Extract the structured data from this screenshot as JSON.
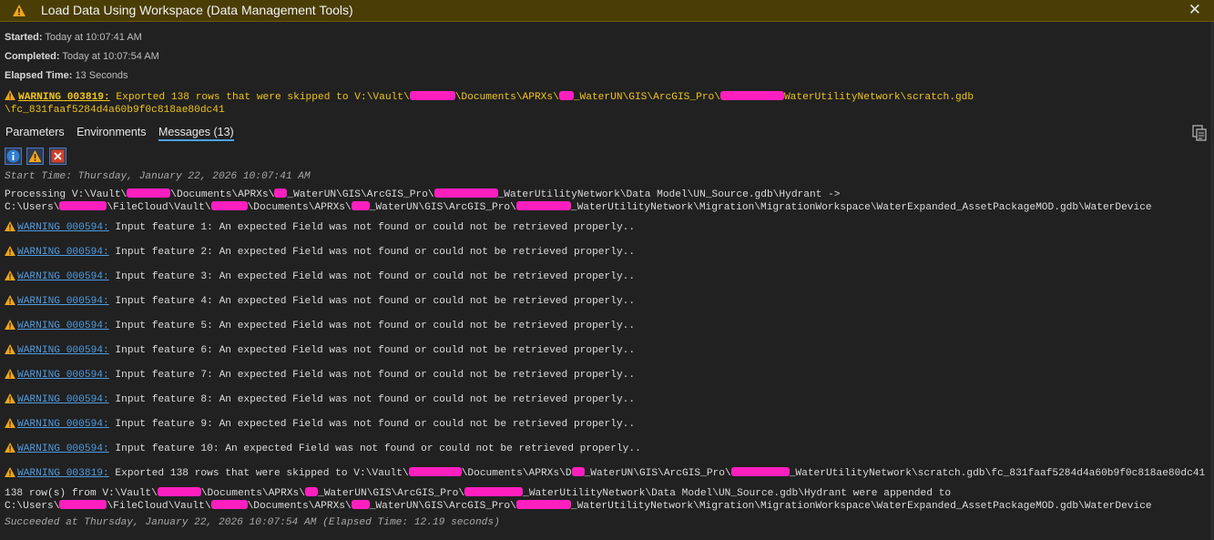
{
  "window": {
    "title": "Load Data Using Workspace (Data Management Tools)",
    "title_icon": "warning-icon",
    "close_icon": "close-icon",
    "accent_color": "#4a3d05"
  },
  "meta": {
    "started_label": "Started:",
    "started_value": "Today at 10:07:41 AM",
    "completed_label": "Completed:",
    "completed_value": "Today at 10:07:54 AM",
    "elapsed_label": "Elapsed Time:",
    "elapsed_value": "13 Seconds"
  },
  "top_warning": {
    "code": "WARNING 003819:",
    "text1": " Exported 138 rows that were skipped to V:\\Vault\\",
    "text2": "\\Documents\\APRXs\\",
    "text3": "_WaterUN\\GIS\\ArcGIS_Pro\\",
    "text4": "WaterUtilityNetwork\\scratch.gdb",
    "line2": "\\fc_831faaf5284d4a60b9f0c818ae80dc41"
  },
  "tabs": [
    {
      "label": "Parameters",
      "active": false
    },
    {
      "label": "Environments",
      "active": false
    },
    {
      "label": "Messages (13)",
      "active": true
    }
  ],
  "filters": {
    "info_icon": "info-icon",
    "warning_icon": "warning-icon",
    "error_icon": "error-icon"
  },
  "messages": {
    "start_time": "Start Time: Thursday, January 22, 2026 10:07:41 AM",
    "proc_a1": "Processing V:\\Vault\\",
    "proc_a2": "\\Documents\\APRXs\\",
    "proc_a3": "_WaterUN\\GIS\\ArcGIS_Pro\\",
    "proc_a4": "_WaterUtilityNetwork\\Data Model\\UN_Source.gdb\\Hydrant ->",
    "proc_b1": "C:\\Users\\",
    "proc_b2": "\\FileCloud\\Vault\\",
    "proc_b3": "\\Documents\\APRXs\\",
    "proc_b4": "_WaterUN\\GIS\\ArcGIS_Pro\\",
    "proc_b5": "_WaterUtilityNetwork\\Migration\\MigrationWorkspace\\WaterExpanded_AssetPackageMOD.gdb\\WaterDevice",
    "warnings": [
      {
        "code": "WARNING 000594:",
        "text": " Input feature 1: An expected Field was not found or could not be retrieved properly.."
      },
      {
        "code": "WARNING 000594:",
        "text": " Input feature 2: An expected Field was not found or could not be retrieved properly.."
      },
      {
        "code": "WARNING 000594:",
        "text": " Input feature 3: An expected Field was not found or could not be retrieved properly.."
      },
      {
        "code": "WARNING 000594:",
        "text": " Input feature 4: An expected Field was not found or could not be retrieved properly.."
      },
      {
        "code": "WARNING 000594:",
        "text": " Input feature 5: An expected Field was not found or could not be retrieved properly.."
      },
      {
        "code": "WARNING 000594:",
        "text": " Input feature 6: An expected Field was not found or could not be retrieved properly.."
      },
      {
        "code": "WARNING 000594:",
        "text": " Input feature 7: An expected Field was not found or could not be retrieved properly.."
      },
      {
        "code": "WARNING 000594:",
        "text": " Input feature 8: An expected Field was not found or could not be retrieved properly.."
      },
      {
        "code": "WARNING 000594:",
        "text": " Input feature 9: An expected Field was not found or could not be retrieved properly.."
      },
      {
        "code": "WARNING 000594:",
        "text": " Input feature 10: An expected Field was not found or could not be retrieved properly.."
      }
    ],
    "w11_code": "WARNING 003819:",
    "w11_t1": " Exported 138 rows that were skipped to V:\\Vault\\",
    "w11_t2": "\\Documents\\APRXs\\D",
    "w11_t3": "_WaterUN\\GIS\\ArcGIS_Pro\\",
    "w11_t4": "_WaterUtilityNetwork\\scratch.gdb\\fc_831faaf5284d4a60b9f0c818ae80dc41",
    "app_a1": "138 row(s) from V:\\Vault\\",
    "app_a2": "\\Documents\\APRXs\\",
    "app_a3": "_WaterUN\\GIS\\ArcGIS_Pro\\",
    "app_a4": "_WaterUtilityNetwork\\Data Model\\UN_Source.gdb\\Hydrant were appended to",
    "app_b1": "C:\\Users\\",
    "app_b2": "\\FileCloud\\Vault\\",
    "app_b3": "\\Documents\\APRXs\\",
    "app_b4": "_WaterUN\\GIS\\ArcGIS_Pro\\",
    "app_b5": "_WaterUtilityNetwork\\Migration\\MigrationWorkspace\\WaterExpanded_AssetPackageMOD.gdb\\WaterDevice",
    "succeeded": "Succeeded at Thursday, January 22, 2026 10:07:54 AM (Elapsed Time: 12.19 seconds)"
  }
}
